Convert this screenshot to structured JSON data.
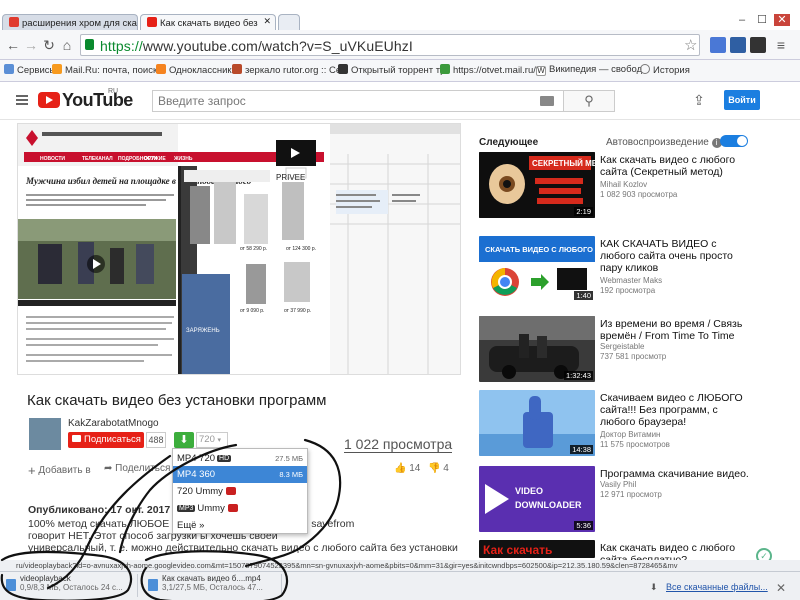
{
  "browser": {
    "tabs": [
      {
        "title": "расширения хром для ска",
        "active": false
      },
      {
        "title": "Как скачать видео без",
        "active": true
      }
    ],
    "url_protocol": "https://",
    "url_host": "www.youtube.com",
    "url_path": "/watch?v=S_uVKuEUhzI",
    "bookmarks": [
      "Сервисы",
      "Mail.Ru: почта, поиск",
      "Одноклассники",
      "зеркало rutor.org :: Ce",
      "Открытый торрент тр",
      "https://otvet.mail.ru/",
      "Википедия — свобод",
      "История"
    ]
  },
  "youtube_header": {
    "logo_text": "YouTube",
    "logo_region": "RU",
    "search_placeholder": "Введите запрос",
    "signin_label": "Войти"
  },
  "video": {
    "title": "Как скачать видео без установки программ",
    "channel": "KakZarabotatMnogo",
    "subscribe_label": "Подписаться",
    "subscribers": "488",
    "quality_label": "720",
    "views": "1 022 просмотра",
    "add_to_label": "Добавить в",
    "share_label": "Поделиться",
    "likes": "14",
    "dislikes": "4",
    "embedded_page": {
      "nav": [
        "НОВОСТИ",
        "ТЕЛЕКАНАЛ",
        "ПОДРОБНОСТИ",
        "ОРУЖИЕ",
        "ЖИЗНЬ"
      ],
      "headline": "Мужчина избил детей на площадке в Краснодаре: видео",
      "ad_brand": "PRIVEE",
      "prices": [
        "от 58 290 р.",
        "от 124 300 р.",
        "от 9 090 р.",
        "от 37 990 р."
      ]
    }
  },
  "download_menu": {
    "items": [
      {
        "label": "MP4 720",
        "tag": "HD",
        "size": "27.5 МБ",
        "selected": false
      },
      {
        "label": "MP4 360",
        "tag": "",
        "size": "8.3 МБ",
        "selected": true
      },
      {
        "label": "720 Ummy",
        "tag": "",
        "size": "",
        "selected": false
      },
      {
        "label": "Ummy",
        "tag": "MP3",
        "size": "",
        "selected": false
      },
      {
        "label": "Ещё »",
        "tag": "",
        "size": "",
        "selected": false
      }
    ]
  },
  "description": {
    "published": "Опубликовано: 17 окт. 2017 г.",
    "lines": [
      "100% метод скачать ЛЮБОЕ видео                                   программ, даже если savefrom",
      "говорит НЕТ. Этот способ загрузки                                  ы хочешь своей",
      "универсальный, т. е. можно действительно скачать видео с любого сайта без установки"
    ]
  },
  "sidebar": {
    "heading": "Следующее",
    "autoplay_label": "Автовоспроизведение",
    "items": [
      {
        "title": "Как скачать видео с любого сайта (Секретный метод)",
        "channel": "Mihail Kozlov",
        "views": "1 082 903 просмотра",
        "duration": "2:19",
        "thumb_text": "СЕКРЕТНЫЙ МЕТОД"
      },
      {
        "title": "КАК СКАЧАТЬ ВИДЕО с любого сайта очень просто пару кликов",
        "channel": "Webmaster Maks",
        "views": "192 просмотра",
        "duration": "1:40",
        "thumb_text": "СКАЧАТЬ ВИДЕО С ЛЮБОГО САЙТА"
      },
      {
        "title": "Из времени во время / Связь времён / From Time To Time",
        "channel": "Sergeistable",
        "views": "737 581 просмотр",
        "duration": "1:32:43",
        "thumb_text": ""
      },
      {
        "title": "Скачиваем видео с ЛЮБОГО сайта!!! Без программ, с любого браузера!",
        "channel": "Доктор Витамин",
        "views": "11 575 просмотров",
        "duration": "14:38",
        "thumb_text": ""
      },
      {
        "title": "Программа скачивание видео.",
        "channel": "Vasily Phil",
        "views": "12 971 просмотр",
        "duration": "5:36",
        "thumb_text": "VIDEO DOWNLOADER"
      },
      {
        "title": "Как скачать видео с любого сайта бесплатно?",
        "channel": "",
        "views": "",
        "duration": "",
        "thumb_text": "Как скачать"
      }
    ]
  },
  "status_url": "ru/videoplayback?id=o-avnuxaxjvh-aome.googlevideo.com&mt=1507879074523395&mn=sn-gvnuxaxjvh-aome&pbits=0&mm=31&gir=yes&initcwndbps=602500&ip=212.35.180.59&clen=8728465&mv",
  "downloads": [
    {
      "name": "videoplayback",
      "progress": "0,9/8,3 МБ, Осталось 24 с..."
    },
    {
      "name": "Как скачать видео б....mp4",
      "progress": "3,1/27,5 МБ, Осталось 47..."
    }
  ],
  "downloads_all_label": "Все скачанные файлы...",
  "colors": {
    "youtube_red": "#e62117",
    "link_blue": "#1b7ee0",
    "download_green": "#3cae3c",
    "menu_highlight": "#3d86d6"
  }
}
